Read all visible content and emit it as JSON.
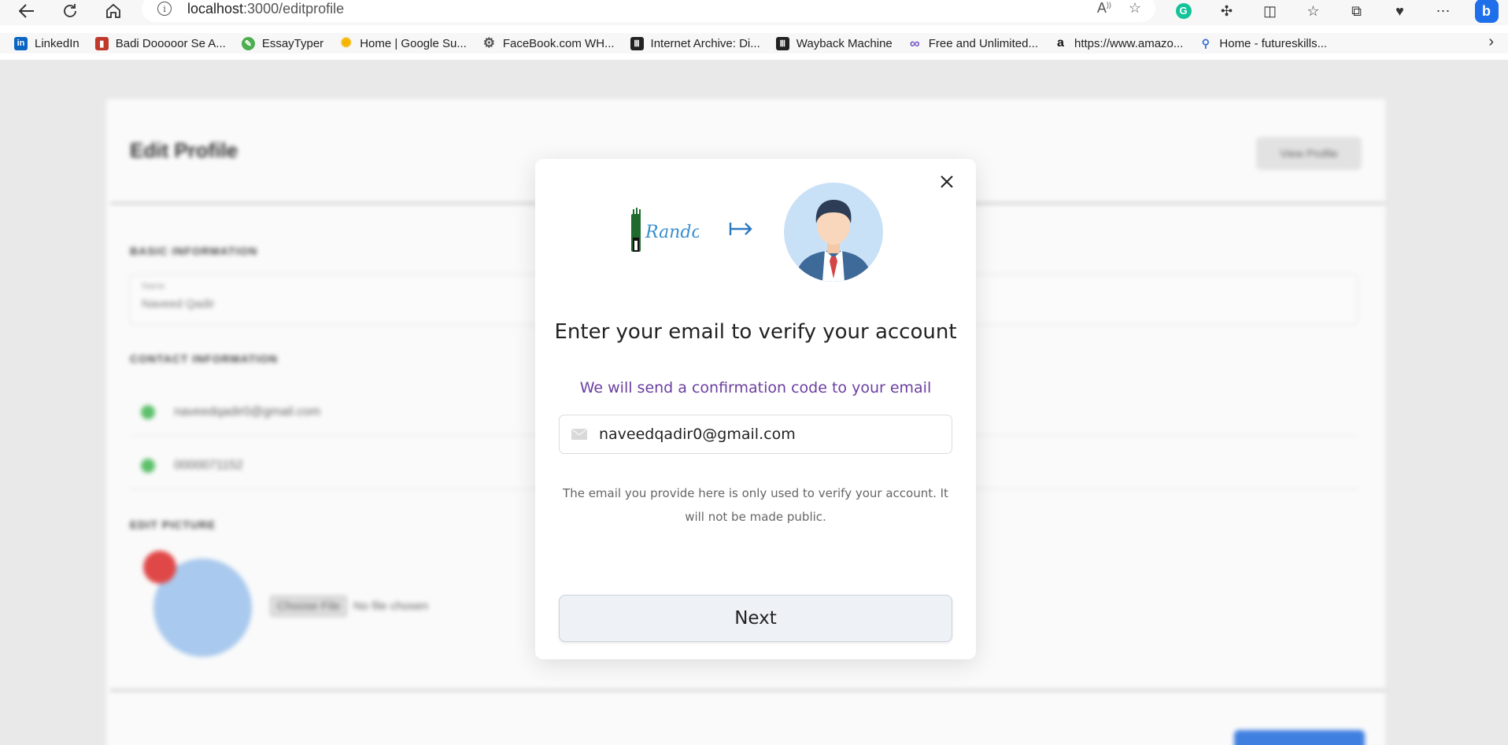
{
  "browser": {
    "url_host": "localhost",
    "url_path": ":3000/editprofile",
    "bookmarks": [
      {
        "label": "LinkedIn",
        "icon": "linkedin-icon",
        "color": "#0a66c2"
      },
      {
        "label": "Badi Dooooor Se A...",
        "icon": "badi-icon",
        "color": "#c0392b"
      },
      {
        "label": "EssayTyper",
        "icon": "essaytyper-icon",
        "color": "#4caf50"
      },
      {
        "label": "Home | Google Su...",
        "icon": "sun-icon",
        "color": "#f4b400"
      },
      {
        "label": "FaceBook.com WH...",
        "icon": "gear-icon",
        "color": "#555555"
      },
      {
        "label": "Internet Archive: Di...",
        "icon": "archive-icon",
        "color": "#222222"
      },
      {
        "label": "Wayback Machine",
        "icon": "archive-icon",
        "color": "#222222"
      },
      {
        "label": "Free and Unlimited...",
        "icon": "infinity-icon",
        "color": "#7b5cc4"
      },
      {
        "label": "https://www.amazo...",
        "icon": "amazon-icon",
        "color": "#111111"
      },
      {
        "label": "Home - futureskills...",
        "icon": "futureskills-icon",
        "color": "#3a6fd8"
      }
    ]
  },
  "background_page": {
    "title": "Edit Profile",
    "view_button": "View Profile",
    "basic_info_label": "BASIC INFORMATION",
    "name_field_label": "Name",
    "name_value": "Naveed Qadir",
    "contact_label": "CONTACT INFORMATION",
    "email_value": "naveedqadir0@gmail.com",
    "phone_value": "0000071152",
    "picture_label": "EDIT PICTURE",
    "choose_file": "Choose File",
    "no_file": "No file chosen"
  },
  "modal": {
    "title": "Enter your email to verify your account",
    "subtitle": "We will send a confirmation code to your email",
    "email_value": "naveedqadir0@gmail.com",
    "note": "The email you provide here is only used to verify your account. It will not be made public.",
    "next_label": "Next",
    "logo_text": "Random",
    "accent_color": "#6b3fa0"
  }
}
